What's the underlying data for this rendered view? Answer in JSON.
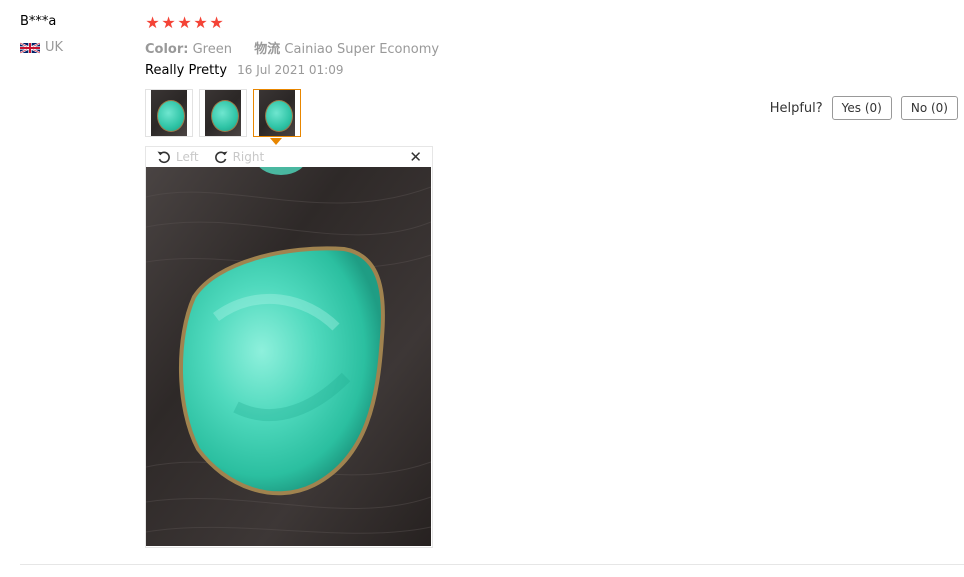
{
  "review": {
    "reviewer": "B***a",
    "country": "UK",
    "rating": 5,
    "sku": {
      "color_label": "Color:",
      "color_value": "Green",
      "shipping_label": "物流",
      "shipping_value": "Cainiao Super Economy"
    },
    "feedback_text": "Really Pretty",
    "date": "16 Jul 2021 01:09",
    "thumbnails": [
      "thumbnail-1",
      "thumbnail-2",
      "thumbnail-3"
    ],
    "active_thumbnail": 3
  },
  "helpful": {
    "question": "Helpful?",
    "yes_label": "Yes (0)",
    "no_label": "No (0)"
  },
  "viewer": {
    "rotate_left": "Left",
    "rotate_right": "Right",
    "close_glyph": "✕"
  },
  "colors": {
    "star": "#f44336",
    "active_border": "#e88600",
    "muted_text": "#999999"
  },
  "icons": [
    "star-icon",
    "uk-flag-icon",
    "rotate-left-icon",
    "rotate-right-icon",
    "close-icon"
  ]
}
